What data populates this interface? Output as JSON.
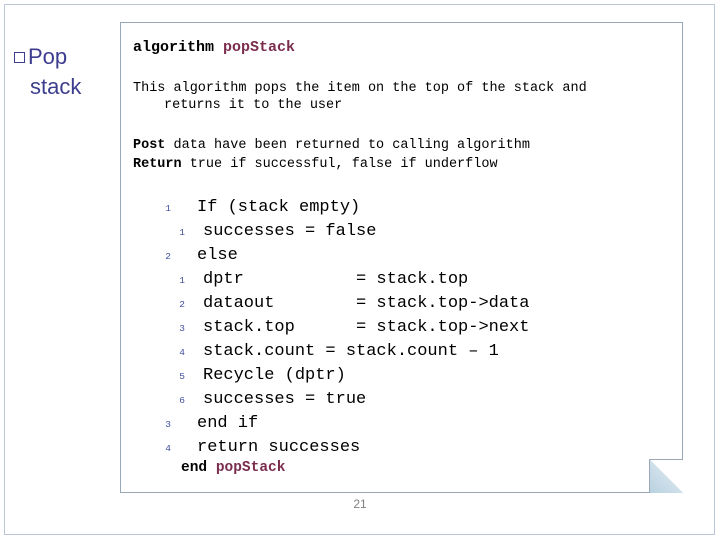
{
  "slide": {
    "title_line1": "Pop",
    "title_line2": "stack",
    "page_number": "21"
  },
  "algorithm": {
    "heading_prefix": "algorithm ",
    "heading_name": "popStack",
    "description_line1": "This algorithm pops the item on the top of the stack and",
    "description_line2": "returns it to the user",
    "post_label": "Post",
    "post_text": " data have been returned to calling algorithm",
    "return_label": "Return",
    "return_text": " true if successful, false if underflow",
    "end_keyword": "end ",
    "end_name": "popStack",
    "lines": [
      {
        "num": "1",
        "indent": 1,
        "code": "If (stack empty)"
      },
      {
        "num": "1",
        "indent": 2,
        "code": "successes = false"
      },
      {
        "num": "2",
        "indent": 1,
        "code": "else"
      },
      {
        "num": "1",
        "indent": 2,
        "code": "dptr           = stack.top"
      },
      {
        "num": "2",
        "indent": 2,
        "code": "dataout        = stack.top->data"
      },
      {
        "num": "3",
        "indent": 2,
        "code": "stack.top      = stack.top->next"
      },
      {
        "num": "4",
        "indent": 2,
        "code": "stack.count = stack.count – 1"
      },
      {
        "num": "5",
        "indent": 2,
        "code": "Recycle (dptr)"
      },
      {
        "num": "6",
        "indent": 2,
        "code": "successes = true"
      },
      {
        "num": "3",
        "indent": 1,
        "code": "end if"
      },
      {
        "num": "4",
        "indent": 1,
        "code": "return successes"
      }
    ]
  },
  "colors": {
    "title": "#3d3d8f",
    "algorithm_name": "#7b2d4e",
    "line_number": "#3f4fa0",
    "frame_border": "#b9c7d8",
    "card_border": "#9aa7b8"
  }
}
